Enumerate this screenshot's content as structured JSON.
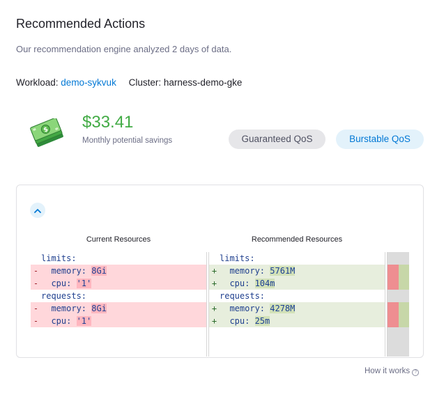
{
  "header": {
    "title": "Recommended Actions",
    "subtitle": "Our recommendation engine analyzed 2 days of data."
  },
  "workload": {
    "workload_label": "Workload:",
    "workload_name": "demo-sykvuk",
    "cluster_label": "Cluster:",
    "cluster_name": "harness-demo-gke"
  },
  "savings": {
    "amount": "$33.41",
    "label": "Monthly potential savings",
    "icon": "money-icon"
  },
  "qos": {
    "guaranteed_label": "Guaranteed QoS",
    "burstable_label": "Burstable QoS",
    "selected": "Burstable QoS"
  },
  "diff": {
    "current_header": "Current Resources",
    "recommended_header": "Recommended Resources",
    "left": [
      {
        "type": "ctx",
        "sign": " ",
        "key": "limits",
        "sep": ":",
        "value": ""
      },
      {
        "type": "del",
        "sign": "-",
        "key": "  memory",
        "sep": ": ",
        "value": "8Gi"
      },
      {
        "type": "del",
        "sign": "-",
        "key": "  cpu",
        "sep": ": ",
        "value": "'1'"
      },
      {
        "type": "ctx",
        "sign": " ",
        "key": "requests",
        "sep": ":",
        "value": ""
      },
      {
        "type": "del",
        "sign": "-",
        "key": "  memory",
        "sep": ": ",
        "value": "8Gi"
      },
      {
        "type": "del",
        "sign": "-",
        "key": "  cpu",
        "sep": ": ",
        "value": "'1'"
      }
    ],
    "right": [
      {
        "type": "ctx",
        "sign": " ",
        "key": "limits",
        "sep": ":",
        "value": ""
      },
      {
        "type": "add",
        "sign": "+",
        "key": "  memory",
        "sep": ": ",
        "value": "5761M"
      },
      {
        "type": "add",
        "sign": "+",
        "key": "  cpu",
        "sep": ": ",
        "value": "104m"
      },
      {
        "type": "ctx",
        "sign": " ",
        "key": "requests",
        "sep": ":",
        "value": ""
      },
      {
        "type": "add",
        "sign": "+",
        "key": "  memory",
        "sep": ": ",
        "value": "4278M"
      },
      {
        "type": "add",
        "sign": "+",
        "key": "  cpu",
        "sep": ": ",
        "value": "25m"
      }
    ]
  },
  "footer": {
    "how_it_works": "How it works",
    "help_icon": "question-circle-icon"
  },
  "colors": {
    "accent": "#0278d5",
    "savings_green": "#42ab45",
    "deleted_bg": "#ffd7db",
    "added_bg": "#e7eedd"
  }
}
